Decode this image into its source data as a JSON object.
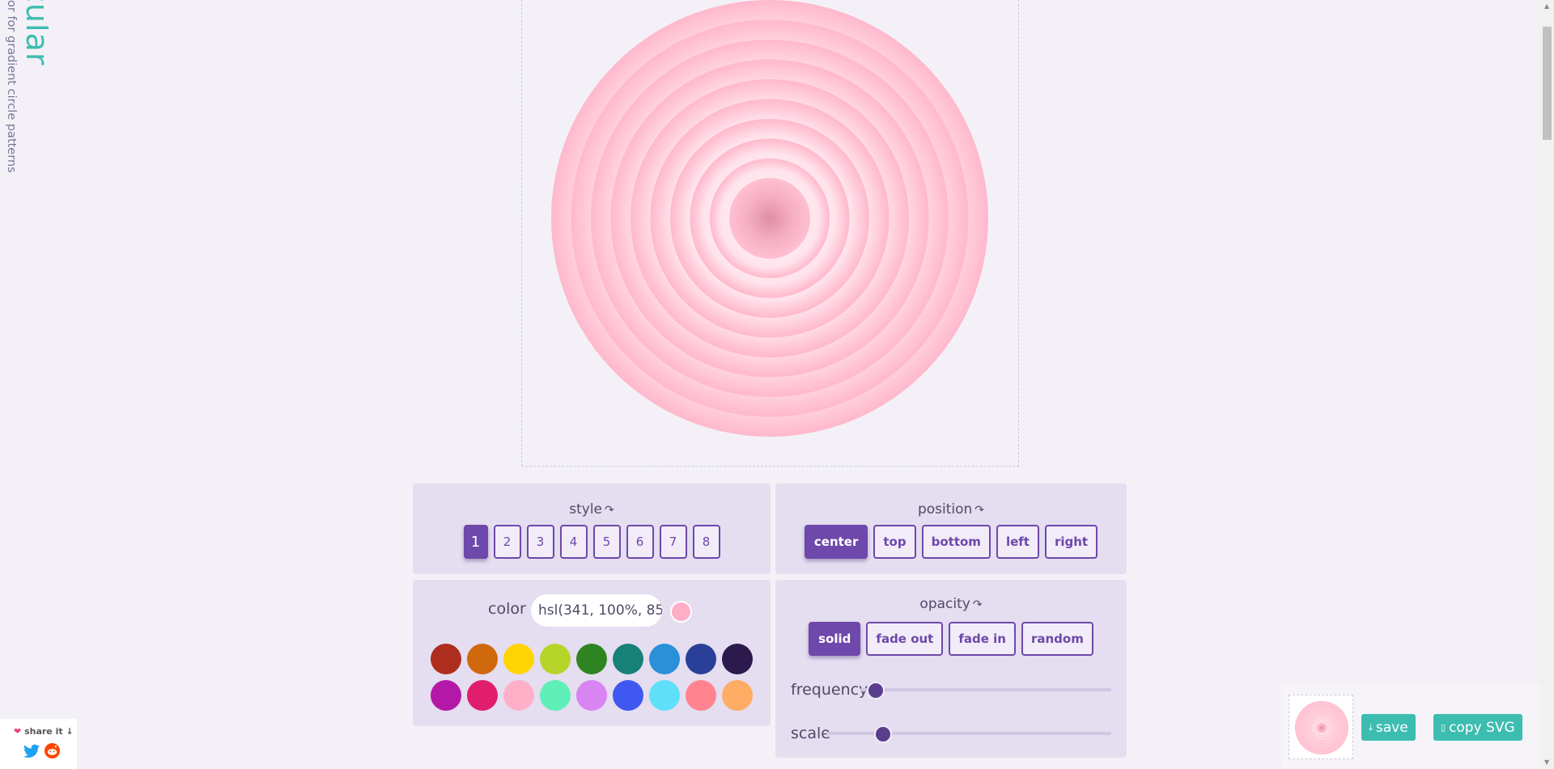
{
  "brand": {
    "title": "cular",
    "subtitle": "or for gradient circle patterns"
  },
  "style": {
    "title": "style",
    "cycle_icon": "↷",
    "options": [
      "1",
      "2",
      "3",
      "4",
      "5",
      "6",
      "7",
      "8"
    ],
    "selected": "1"
  },
  "position": {
    "title": "position",
    "cycle_icon": "↷",
    "options": [
      "center",
      "top",
      "bottom",
      "left",
      "right"
    ],
    "selected": "center"
  },
  "color": {
    "label": "color",
    "value": "hsl(341, 100%, 85",
    "preview": "#ffaec7",
    "swatches": [
      "#ad2e1e",
      "#d0680e",
      "#ffd400",
      "#b7d42a",
      "#2e8420",
      "#178078",
      "#2a90d8",
      "#2a3f98",
      "#2c1a4c",
      "#b418a6",
      "#e01e6c",
      "#ffb0c8",
      "#5ef0b8",
      "#d884f2",
      "#4058f2",
      "#60e0f8",
      "#ff8490",
      "#ffac64"
    ]
  },
  "opacity": {
    "title": "opacity",
    "cycle_icon": "↷",
    "options": [
      "solid",
      "fade out",
      "fade in",
      "random"
    ],
    "selected": "solid"
  },
  "sliders": {
    "frequency_label": "frequency",
    "frequency_value": 0.06,
    "scale_label": "scale",
    "scale_value": 0.2
  },
  "share": {
    "text": "share it",
    "arrow": "↓"
  },
  "actions": {
    "save_label": "save",
    "copy_label": "copy SVG"
  },
  "accent": "#6e48aa",
  "teal": "#3dbdb0"
}
